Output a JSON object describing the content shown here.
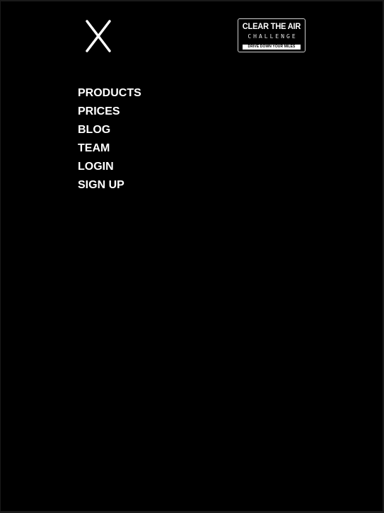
{
  "header": {
    "close_icon": "close-icon",
    "logo": {
      "title": "CLEAR THE AIR",
      "subtitle": "CHALLENGE",
      "tagline": "DRIVE DOWN YOUR MILES"
    }
  },
  "menu": {
    "items": [
      {
        "label": "PRODUCTS"
      },
      {
        "label": "PRICES"
      },
      {
        "label": "BLOG"
      },
      {
        "label": "TEAM"
      },
      {
        "label": "LOGIN"
      },
      {
        "label": "SIGN UP"
      }
    ]
  },
  "colors": {
    "background": "#000000",
    "text": "#ffffff"
  }
}
